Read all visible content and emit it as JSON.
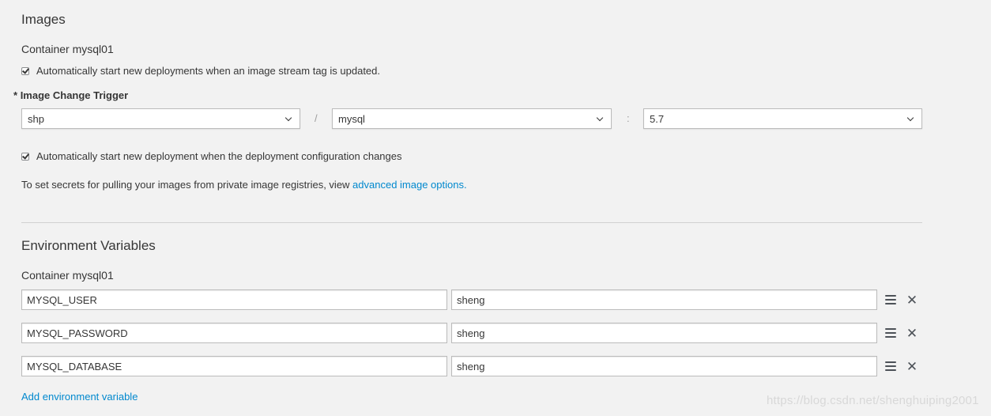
{
  "images": {
    "title": "Images",
    "container_label": "Container mysql01",
    "auto_image_checkbox": {
      "checked": true,
      "label": "Automatically start new deployments when an image stream tag is updated."
    },
    "trigger": {
      "required_marker": "*",
      "label": "Image Change Trigger",
      "namespace": "shp",
      "image_stream": "mysql",
      "tag": "5.7",
      "separator_slash": "/",
      "separator_colon": ":"
    },
    "auto_config_checkbox": {
      "checked": true,
      "label": "Automatically start new deployment when the deployment configuration changes"
    },
    "secrets_text": "To set secrets for pulling your images from private image registries, view ",
    "secrets_link": "advanced image options."
  },
  "environment": {
    "title": "Environment Variables",
    "container_label": "Container mysql01",
    "variables": [
      {
        "name": "MYSQL_USER",
        "value": "sheng"
      },
      {
        "name": "MYSQL_PASSWORD",
        "value": "sheng"
      },
      {
        "name": "MYSQL_DATABASE",
        "value": "sheng"
      }
    ],
    "add_link": "Add environment variable"
  },
  "icons": {
    "dropdown": "chevron-down-icon",
    "reorder": "drag-handle-icon",
    "remove": "close-icon"
  },
  "colors": {
    "link": "#0088ce",
    "background": "#f2f2f2",
    "text": "#363636"
  },
  "watermark": "https://blog.csdn.net/shenghuiping2001"
}
